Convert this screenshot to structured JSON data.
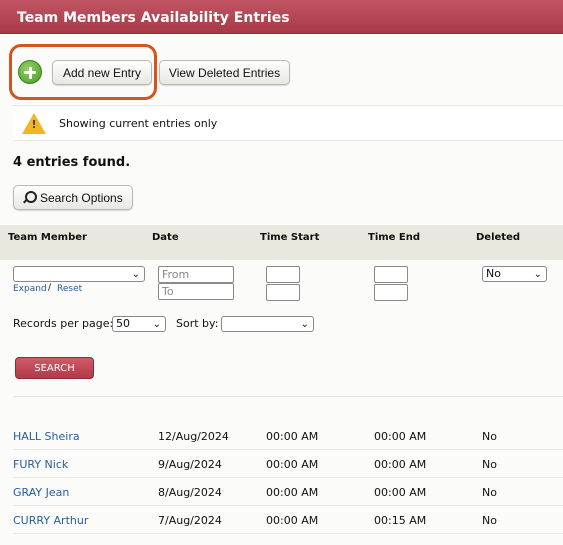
{
  "header": {
    "title": "Team Members Availability Entries"
  },
  "toolbar": {
    "add_label": "Add new Entry",
    "deleted_label": "View Deleted Entries"
  },
  "notice": {
    "text": "Showing current entries only",
    "mark": "!"
  },
  "summary": {
    "count_text": "4 entries found."
  },
  "search_options": {
    "label": "Search Options"
  },
  "filters": {
    "headers": {
      "member": "Team Member",
      "date": "Date",
      "time_start": "Time Start",
      "time_end": "Time End",
      "deleted": "Deleted"
    },
    "member_value": "",
    "date_from_placeholder": "From",
    "date_to_placeholder": "To",
    "expand_label": "Expand",
    "slash": "/",
    "reset_label": "Reset",
    "deleted_value": "No"
  },
  "paging": {
    "records_label": "Records per page:",
    "records_value": "50",
    "sort_label": "Sort by:",
    "sort_value": ""
  },
  "actions": {
    "search_label": "SEARCH"
  },
  "entries": [
    {
      "name": "HALL Sheira",
      "date": "12/Aug/2024",
      "start": "00:00 AM",
      "end": "00:00 AM",
      "deleted": "No"
    },
    {
      "name": "FURY Nick",
      "date": "9/Aug/2024",
      "start": "00:00 AM",
      "end": "00:00 AM",
      "deleted": "No"
    },
    {
      "name": "GRAY Jean",
      "date": "8/Aug/2024",
      "start": "00:00 AM",
      "end": "00:00 AM",
      "deleted": "No"
    },
    {
      "name": "CURRY Arthur",
      "date": "7/Aug/2024",
      "start": "00:00 AM",
      "end": "00:15 AM",
      "deleted": "No"
    }
  ],
  "colors": {
    "header": "#b4414f",
    "accent_ring": "#d2541f",
    "link": "#245f96"
  }
}
